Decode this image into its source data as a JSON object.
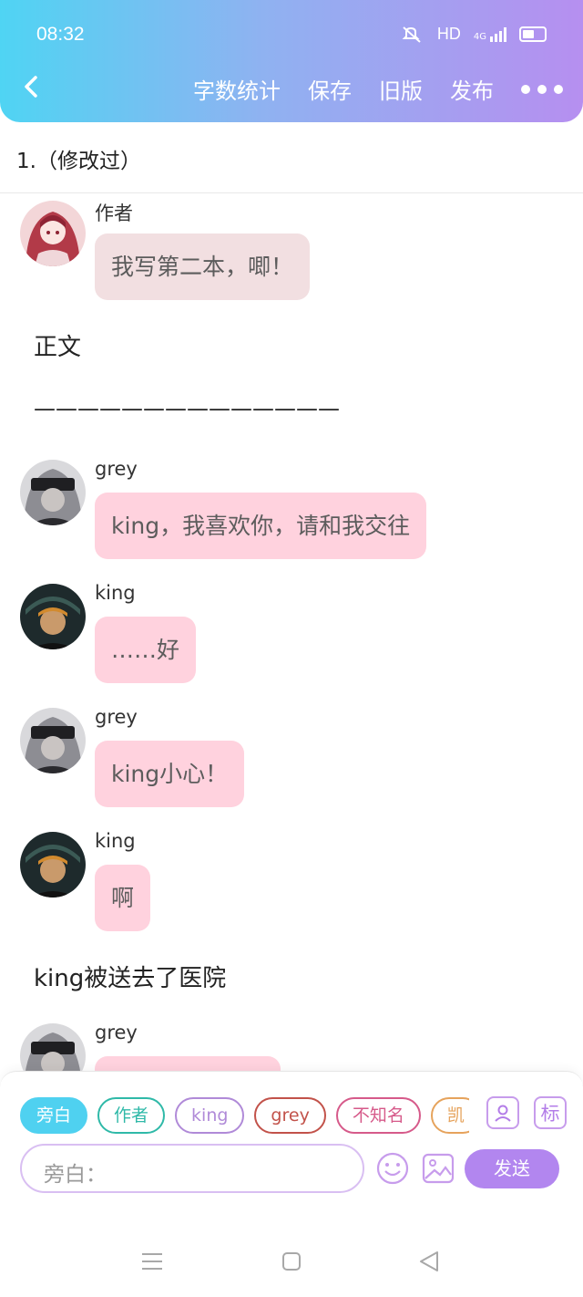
{
  "status_bar": {
    "time": "08:32",
    "hd": "HD",
    "network": "4G"
  },
  "header": {
    "actions": [
      "字数统计",
      "保存",
      "旧版",
      "发布"
    ]
  },
  "chapter": {
    "title": "1.（修改过）"
  },
  "messages": [
    {
      "sender": "作者",
      "text": "我写第二本，唧！",
      "avatar_color": "#c9616a",
      "bubble_color": "#f2dfe1"
    },
    {
      "sender": "grey",
      "text": "king，我喜欢你，请和我交往",
      "avatar_color": "#6c6c72",
      "bubble_color": "#ffd2de"
    },
    {
      "sender": "king",
      "text": "……好",
      "avatar_color": "#2b3a3c",
      "bubble_color": "#ffd2de"
    },
    {
      "sender": "grey",
      "text": "king小心！",
      "avatar_color": "#6c6c72",
      "bubble_color": "#ffd2de"
    },
    {
      "sender": "king",
      "text": "啊",
      "avatar_color": "#2b3a3c",
      "bubble_color": "#ffd2de"
    },
    {
      "sender": "grey",
      "text": "",
      "avatar_color": "#6c6c72",
      "bubble_color": "#ffd2de"
    }
  ],
  "narration": {
    "heading": "正文",
    "separator": "——————————————",
    "line1": "king被送去了医院"
  },
  "composer": {
    "chips": [
      {
        "label": "旁白",
        "color": "#4fd1f0",
        "active": true
      },
      {
        "label": "作者",
        "color": "#2fb9a8",
        "active": false
      },
      {
        "label": "king",
        "color": "#b08ad8",
        "active": false
      },
      {
        "label": "grey",
        "color": "#c2524a",
        "active": false
      },
      {
        "label": "不知名",
        "color": "#d65a8a",
        "active": false
      },
      {
        "label": "凯",
        "color": "#e6a35c",
        "active": false
      }
    ],
    "role_button_icon": "person-icon",
    "mark_button_label": "标",
    "input_placeholder": "旁白：",
    "emoji_icon": "smile-icon",
    "image_icon": "image-icon",
    "send_label": "发送"
  },
  "system_nav": {
    "icons": [
      "menu-icon",
      "home-icon",
      "back-icon"
    ]
  }
}
